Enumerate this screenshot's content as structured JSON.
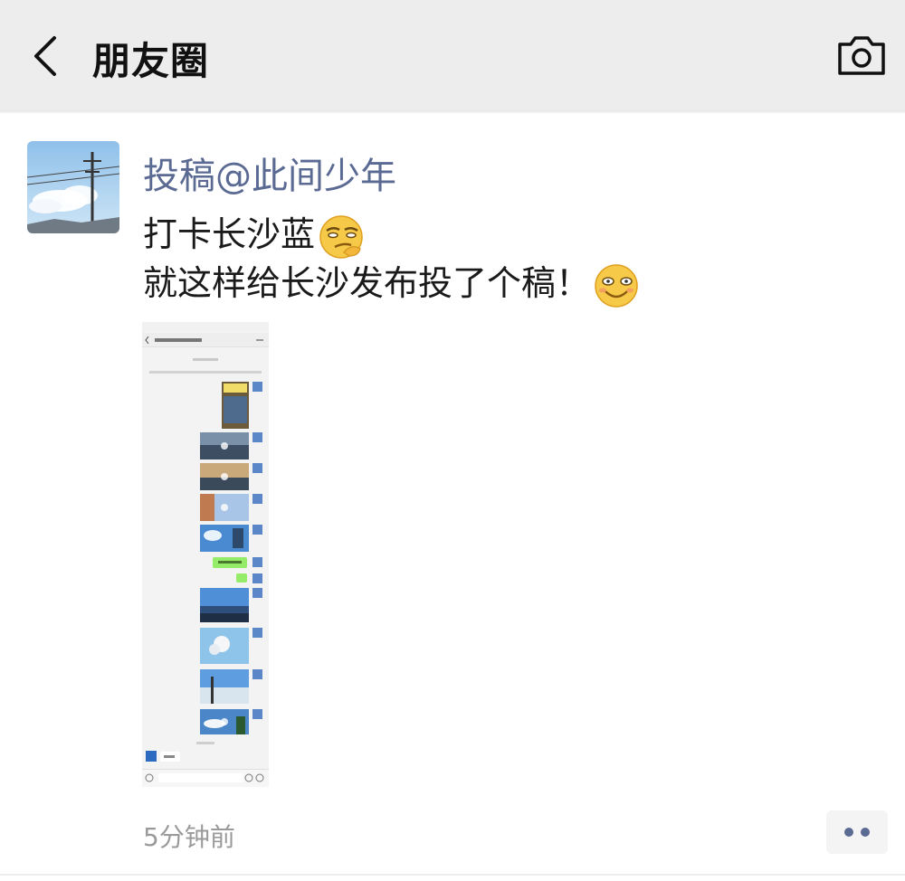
{
  "header": {
    "title": "朋友圈",
    "back_icon": "chevron-left-icon",
    "camera_icon": "camera-icon",
    "background": "#ededed"
  },
  "post": {
    "author": "投稿@此间少年",
    "line1": "打卡长沙蓝",
    "line2": "就这样给长沙发布投了个稿！",
    "line1_emoji": "smirk-emoji",
    "line2_emoji": "grin-emoji",
    "timestamp": "5分钟前",
    "author_color": "#5b6a93"
  }
}
